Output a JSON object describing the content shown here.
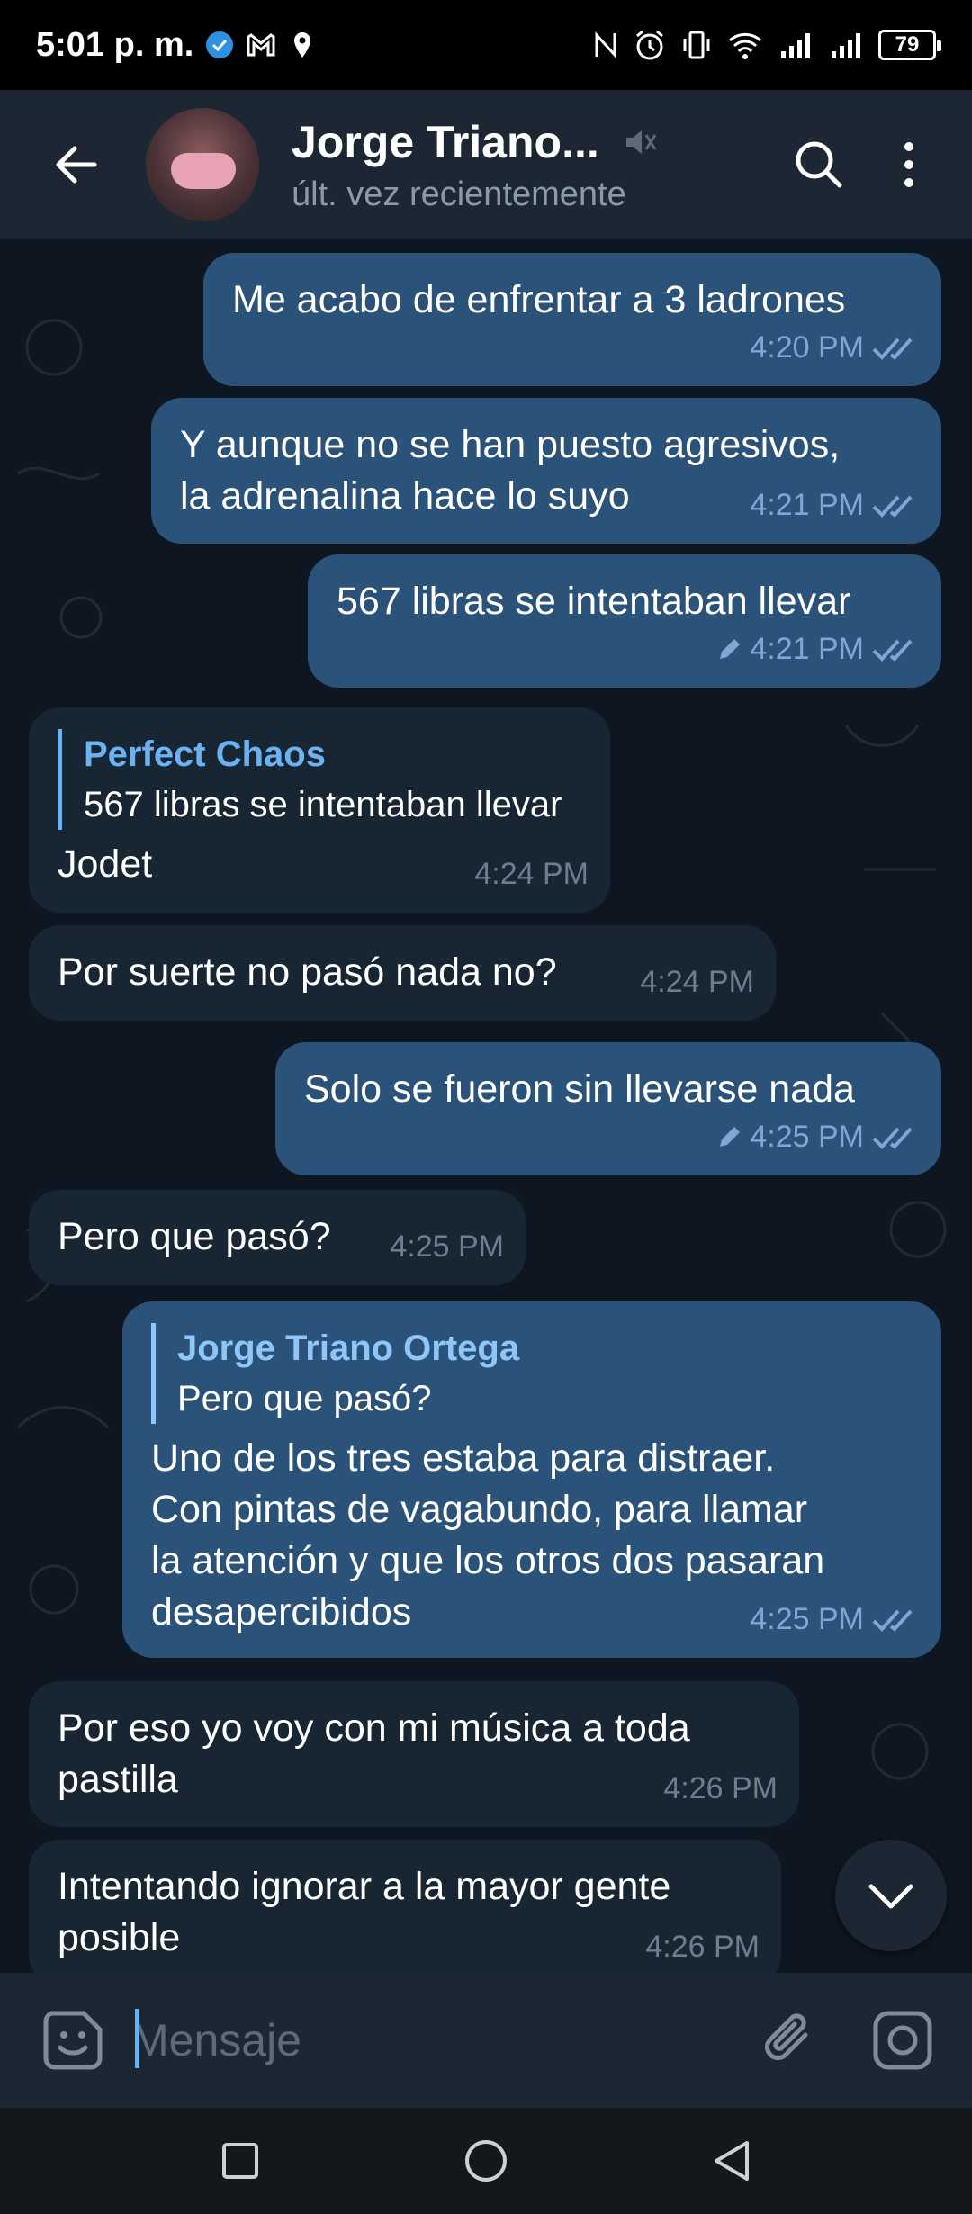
{
  "status_bar": {
    "time": "5:01 p. m.",
    "battery": "79"
  },
  "header": {
    "title": "Jorge Triano...",
    "subtitle": "últ. vez recientemente"
  },
  "colors": {
    "background": "#0e1621",
    "header": "#1c2733",
    "outgoing_bubble": "#2b5278",
    "incoming_bubble": "#182533",
    "accent": "#6ab2f2"
  },
  "messages": [
    {
      "direction": "out",
      "text": "Me acabo de enfrentar a 3 ladrones",
      "time": "4:20 PM",
      "edited": false,
      "read": true
    },
    {
      "direction": "out",
      "text": "Y aunque no se han puesto agresivos,\nla adrenalina hace lo suyo",
      "time": "4:21 PM",
      "edited": false,
      "read": true
    },
    {
      "direction": "out",
      "text": "567 libras se intentaban llevar",
      "time": "4:21 PM",
      "edited": true,
      "read": true
    },
    {
      "direction": "in",
      "reply_name": "Perfect Chaos",
      "reply_text": "567 libras se intentaban llevar",
      "text": "Jodet",
      "time": "4:24 PM"
    },
    {
      "direction": "in",
      "text": "Por suerte no pasó nada no?",
      "time": "4:24 PM"
    },
    {
      "direction": "out",
      "text": "Solo se fueron sin llevarse nada",
      "time": "4:25 PM",
      "edited": true,
      "read": true
    },
    {
      "direction": "in",
      "text": "Pero que pasó?",
      "time": "4:25 PM"
    },
    {
      "direction": "out",
      "reply_name": "Jorge Triano Ortega",
      "reply_text": "Pero que pasó?",
      "text": "Uno de los tres estaba para distraer.\nCon pintas de vagabundo, para llamar\nla atención y que los otros dos pasaran\ndesapercibidos",
      "time": "4:25 PM",
      "edited": false,
      "read": true
    },
    {
      "direction": "in",
      "text": "Por eso yo voy con mi música a toda\npastilla",
      "time": "4:26 PM"
    },
    {
      "direction": "in",
      "text": "Intentando ignorar a la mayor gente\nposible",
      "time": "4:26 PM"
    }
  ],
  "input": {
    "placeholder": "Mensaje"
  }
}
